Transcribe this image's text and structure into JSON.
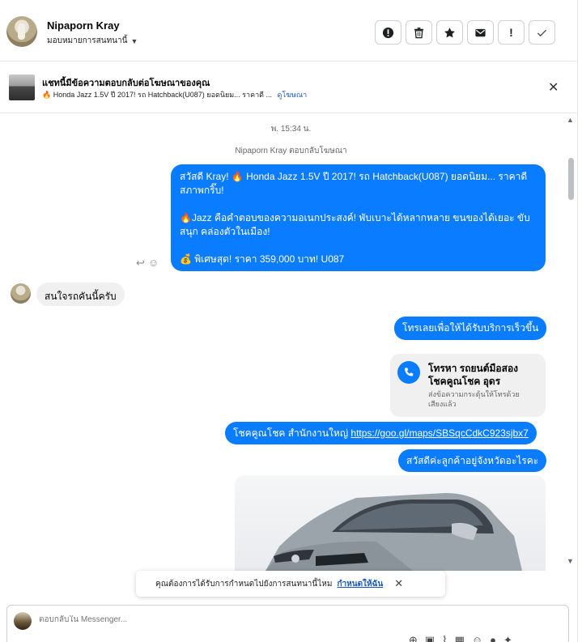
{
  "header": {
    "contact_name": "Nipaporn Kray",
    "assign_label": "มอบหมายการสนทนานี้",
    "actions": [
      {
        "name": "report-button",
        "icon": "alert-circle-icon",
        "glyph": "!"
      },
      {
        "name": "delete-button",
        "icon": "trash-icon",
        "glyph": "🗑"
      },
      {
        "name": "star-button",
        "icon": "star-icon",
        "glyph": "★"
      },
      {
        "name": "mark-unread-button",
        "icon": "envelope-icon",
        "glyph": "✉"
      },
      {
        "name": "follow-up-button",
        "icon": "exclamation-icon",
        "glyph": "!"
      },
      {
        "name": "mark-done-button",
        "icon": "check-icon",
        "glyph": "✓"
      }
    ]
  },
  "ad_banner": {
    "title": "แชทนี้มีข้อความตอบกลับต่อโฆษณาของคุณ",
    "subtitle": "🔥 Honda Jazz 1.5V ปี 2017! รถ Hatchback(U087) ยอดนิยม... ราคาดี ...",
    "link": "ดูโฆษณา"
  },
  "conversation": {
    "timestamp": "พ. 15:34 น.",
    "reply_note": "Nipaporn Kray ตอบกลับโฆษณา",
    "ad_message": {
      "line1": "สวัสดี Kray! 🔥 Honda Jazz 1.5V ปี 2017! รถ Hatchback(U087) ยอดนิยม... ราคาดี สภาพกริ๊บ!",
      "line2": "🔥Jazz คือคำตอบของความอเนกประสงค์! พับเบาะได้หลากหลาย ขนของได้เยอะ ขับสนุก คล่องตัวในเมือง!",
      "line3": "💰 พิเศษสุด! ราคา 359,000 บาท! U087"
    },
    "incoming_message": "สนใจรถคันนี้ครับ",
    "call_prompt": "โทรเลยเพื่อให้ได้รับบริการเร็วขึ้น",
    "call_card": {
      "title": "โทรหา รถยนต์มือสอง โชคคูณโชค อุดร",
      "subtitle": "ส่งข้อความกระตุ้นให้โทรด้วยเสียงแล้ว"
    },
    "office_message_prefix": "โชคคูณโชค สำนักงานใหญ่",
    "office_link": "https://goo.gl/maps/SBSqcCdkC923sjbx7",
    "greeting_message": "สวัสดีค่ะลูกค้าอยู่จังหวัดอะไรคะ"
  },
  "toast": {
    "text": "คุณต้องการได้รับการกำหนดไปยังการสนทนานี้ไหม",
    "action": "กำหนดให้ฉัน"
  },
  "composer": {
    "placeholder": "ตอบกลับใน Messenger..."
  },
  "colors": {
    "accent": "#0a7cff",
    "link": "#1a5ab5"
  }
}
